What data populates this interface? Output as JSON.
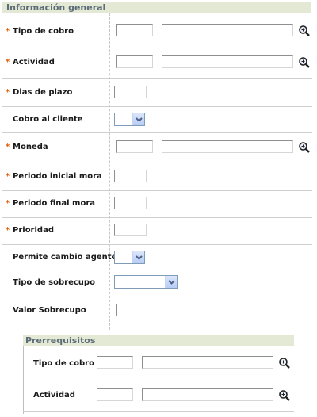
{
  "section_title": "Información general",
  "fields": {
    "tipo_cobro": {
      "label": "Tipo de cobro",
      "code": "",
      "description": ""
    },
    "actividad": {
      "label": "Actividad",
      "code": "",
      "description": ""
    },
    "dias_plazo": {
      "label": "Dias de plazo",
      "value": ""
    },
    "cobro_cliente": {
      "label": "Cobro al cliente",
      "selected": ""
    },
    "moneda": {
      "label": "Moneda",
      "code": "",
      "description": ""
    },
    "periodo_inicial": {
      "label": "Periodo inicial mora",
      "value": ""
    },
    "periodo_final": {
      "label": "Periodo final mora",
      "value": ""
    },
    "prioridad": {
      "label": "Prioridad",
      "value": ""
    },
    "permite_cambio": {
      "label": "Permite cambio agente",
      "selected": ""
    },
    "tipo_sobrecupo": {
      "label": "Tipo de sobrecupo",
      "selected": ""
    },
    "valor_sobrecupo": {
      "label": "Valor Sobrecupo",
      "value": ""
    }
  },
  "required_mark": "*",
  "prerequisites": {
    "title": "Prerrequisitos",
    "tipo_cobro": {
      "label": "Tipo de cobro",
      "code": "",
      "description": ""
    },
    "actividad": {
      "label": "Actividad",
      "code": "",
      "description": ""
    }
  },
  "icons": {
    "lookup": "magnifier-icon",
    "dropdown": "chevron-down-icon"
  },
  "colors": {
    "header_bg": "#e4e9d6",
    "header_text": "#5d6d78",
    "required": "#e35b00"
  }
}
